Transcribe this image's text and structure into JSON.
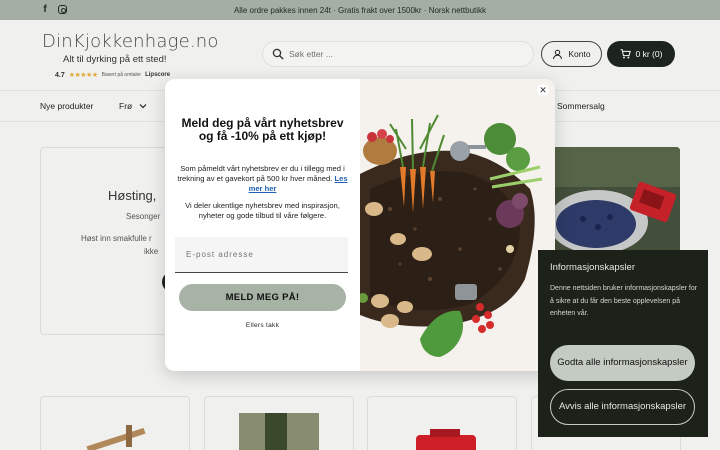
{
  "announcement": {
    "text": "Alle ordre pakkes innen 24t · Gratis frakt over 1500kr · Norsk nettbutikk"
  },
  "header": {
    "logo": "DinKjokkenhage.no",
    "tagline": "Alt til dyrking på ett sted!",
    "rating_score": "4.7",
    "rating_stars": "★★★★★",
    "rating_caption": "Basert på omtaler",
    "rating_brand": "Lipscore",
    "search_placeholder": "Søk etter ...",
    "account_label": "Konto",
    "cart_label": "0 kr (0)"
  },
  "nav": {
    "items": [
      "Nye produkter",
      "Frø",
      "Sommersalg"
    ]
  },
  "hero": {
    "title": "Høsting,",
    "subtitle": "Sesonger",
    "text_line1": "Høst inn smakfulle r",
    "text_line2": "ikke"
  },
  "newsletter": {
    "title": "Meld deg på vårt nyhetsbrev og få -10% på ett kjøp!",
    "text1": "Som påmeldt vårt nyhetsbrev er du i tillegg med i trekning av et gavekort på 500 kr hver måned.",
    "text1_link": "Les mer her",
    "text2": "Vi deler ukentlige nyhetsbrev med inspirasjon, nyheter og gode tilbud til våre følgere.",
    "email_placeholder": "E-post adresse",
    "submit_label": "MELD MEG PÅ!",
    "dismiss_label": "Ellers takk",
    "close_icon": "close-icon"
  },
  "cookies": {
    "title": "Informasjonskapsler",
    "text": "Denne nettsiden bruker informasjonskapsler for å sikre at du får den beste opplevelsen på enheten vår.",
    "accept_label": "Godta alle informasjonskapsler",
    "reject_label": "Avvis alle informasjonskapsler"
  },
  "colors": {
    "announcement_bg": "#a7b1a6",
    "page_bg": "#f3f4f1",
    "dark": "#1e2420",
    "submit_bg": "#a7b4a5",
    "link": "#1f5fb5",
    "cookie_bg": "#1c2119"
  }
}
